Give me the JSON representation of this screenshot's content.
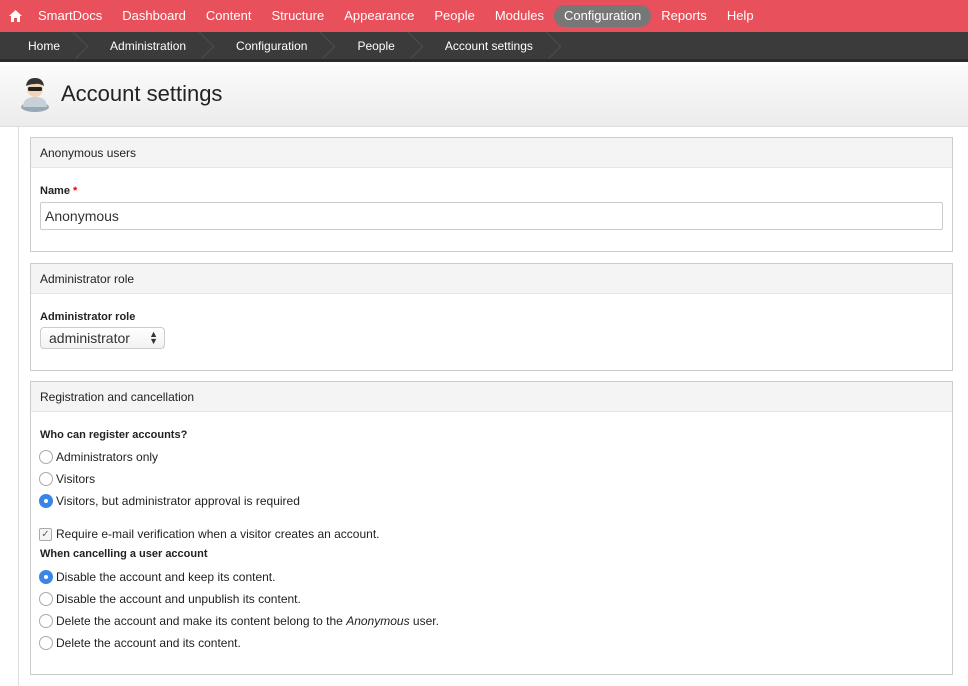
{
  "toolbar": {
    "home_icon": "home-icon",
    "items": [
      "SmartDocs",
      "Dashboard",
      "Content",
      "Structure",
      "Appearance",
      "People",
      "Modules",
      "Configuration",
      "Reports",
      "Help"
    ],
    "active": "Configuration",
    "accent": "#e8505b"
  },
  "breadcrumb": [
    "Home",
    "Administration",
    "Configuration",
    "People",
    "Account settings"
  ],
  "page": {
    "title": "Account settings",
    "icon": "user-icon"
  },
  "anonymous": {
    "legend": "Anonymous users",
    "name_label": "Name",
    "required_mark": "*",
    "name_value": "Anonymous"
  },
  "admin_role": {
    "legend": "Administrator role",
    "label": "Administrator role",
    "selected": "administrator"
  },
  "registration": {
    "legend": "Registration and cancellation",
    "who_label": "Who can register accounts?",
    "who_options": [
      {
        "label": "Administrators only",
        "checked": false
      },
      {
        "label": "Visitors",
        "checked": false
      },
      {
        "label": "Visitors, but administrator approval is required",
        "checked": true
      }
    ],
    "email_verification": {
      "label": "Require e-mail verification when a visitor creates an account.",
      "checked": true
    },
    "cancel_label": "When cancelling a user account",
    "cancel_options": [
      {
        "label": "Disable the account and keep its content.",
        "checked": true
      },
      {
        "label": "Disable the account and unpublish its content.",
        "checked": false
      },
      {
        "label_before": "Delete the account and make its content belong to the ",
        "label_em": "Anonymous",
        "label_after": " user.",
        "checked": false
      },
      {
        "label": "Delete the account and its content.",
        "checked": false
      }
    ]
  }
}
